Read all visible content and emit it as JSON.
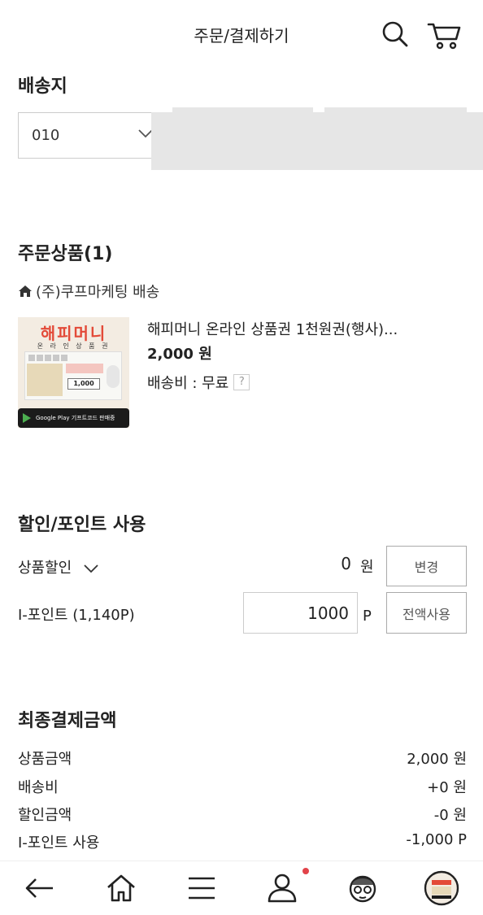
{
  "header": {
    "title": "주문/결제하기",
    "icons": [
      "search-icon",
      "cart-icon"
    ]
  },
  "shipping": {
    "title": "배송지",
    "phone_prefix": "010"
  },
  "order": {
    "title": "주문상품(1)",
    "seller": "(주)쿠프마케팅 배송",
    "product": {
      "name": "해피머니 온라인 상품권 1천원권(행사)...",
      "price": "2,000 원",
      "shipping_fee": "배송비 : 무료",
      "help": "?",
      "thumb_brand": "해피머니",
      "thumb_sub": "온 라 인 상 품 권",
      "thumb_amount": "1,000",
      "thumb_store": "Google Play 기프트코드 판매중"
    }
  },
  "discount": {
    "title": "할인/포인트 사용",
    "product_discount_label": "상품할인",
    "product_discount_value": "0",
    "won": "원",
    "change_button": "변경",
    "ipoint_label": "I-포인트 (1,140P)",
    "ipoint_value": "1000",
    "p_unit": "P",
    "use_all_button": "전액사용"
  },
  "summary": {
    "title": "최종결제금액",
    "rows": [
      {
        "label": "상품금액",
        "value": "2,000 원"
      },
      {
        "label": "배송비",
        "value": "+0 원"
      },
      {
        "label": "할인금액",
        "value": "-0 원"
      },
      {
        "label": "I-포인트 사용",
        "value": "-1,000 P"
      }
    ]
  },
  "bottom_nav": {
    "items": [
      "back-arrow-icon",
      "home-icon",
      "menu-icon",
      "user-icon",
      "face-icon",
      "recent-product-icon"
    ],
    "accent": "#e2434a"
  }
}
